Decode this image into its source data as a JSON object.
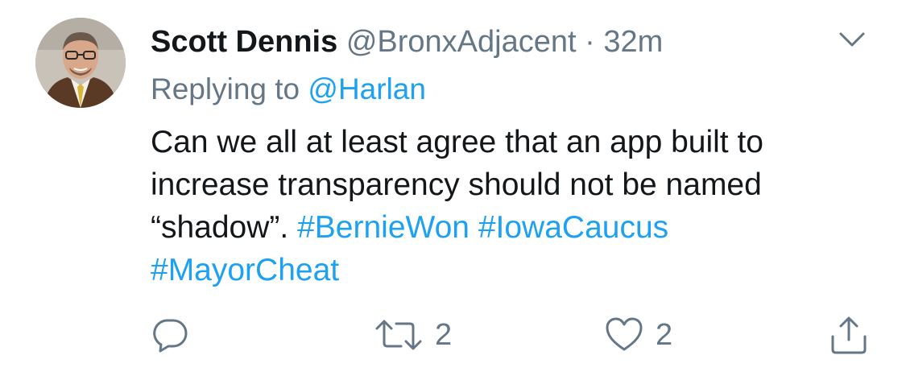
{
  "tweet": {
    "author_name": "Scott Dennis",
    "handle": "@BronxAdjacent",
    "separator": "·",
    "time": "32m",
    "replying_prefix": "Replying to",
    "replying_to": "@Harlan",
    "text_line1": "Can we all at least agree that an app built to",
    "text_line2": "increase transparency should not be named",
    "text_line3_plain": "“shadow”.",
    "hashtag1": "#BernieWon",
    "hashtag2": "#IowaCaucus",
    "hashtag3": "#MayorCheat",
    "retweet_count": "2",
    "like_count": "2"
  },
  "icons": {
    "menu": "chevron-down-icon",
    "reply": "reply-icon",
    "retweet": "retweet-icon",
    "like": "heart-icon",
    "share": "share-icon"
  },
  "colors": {
    "text": "#14171a",
    "secondary": "#657786",
    "link": "#1da1f2",
    "background": "#ffffff"
  }
}
